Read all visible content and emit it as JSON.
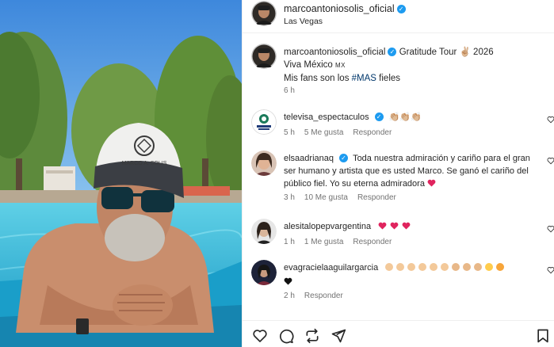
{
  "post": {
    "username": "marcoantoniosolis_oficial",
    "location": "Las Vegas",
    "more": "...",
    "caption_line1": "Gratitude Tour ✌🏼 2026",
    "caption_line2_text": "Viva México",
    "caption_line2_flag": "MX",
    "caption_line3_pre": "Mis fans son los ",
    "caption_hashtag": "#MAS",
    "caption_line3_post": " fieles",
    "time": "6 h",
    "photo_cap_text": "MARCO A. SOLIS"
  },
  "comments": [
    {
      "username": "televisa_espectaculos",
      "verified": true,
      "text": "👏🏼👏🏼👏🏼",
      "time": "5 h",
      "likes": "5 Me gusta",
      "reply": "Responder"
    },
    {
      "username": "elsaadrianaq",
      "verified": true,
      "text_l1": "Toda nuestra admiración y cariño para el gran",
      "text_l2": "ser humano y artista que es usted Marco. Se ganó el cariño del",
      "text_l3": "público fiel. Yo su eterna admiradora",
      "time": "3 h",
      "likes": "10 Me gusta",
      "reply": "Responder"
    },
    {
      "username": "alesitalopepvargentina",
      "verified": false,
      "time": "1 h",
      "likes": "1 Me gusta",
      "reply": "Responder"
    },
    {
      "username": "evagracielaaguilargarcia",
      "verified": false,
      "time": "2 h",
      "reply": "Responder"
    }
  ],
  "colors": {
    "verified": "#1d9bf0",
    "link": "#00376b",
    "meta": "#737373",
    "heart": "#ed4956"
  },
  "icons": [
    "heart-icon",
    "comment-icon",
    "repost-icon",
    "share-icon",
    "bookmark-icon"
  ]
}
